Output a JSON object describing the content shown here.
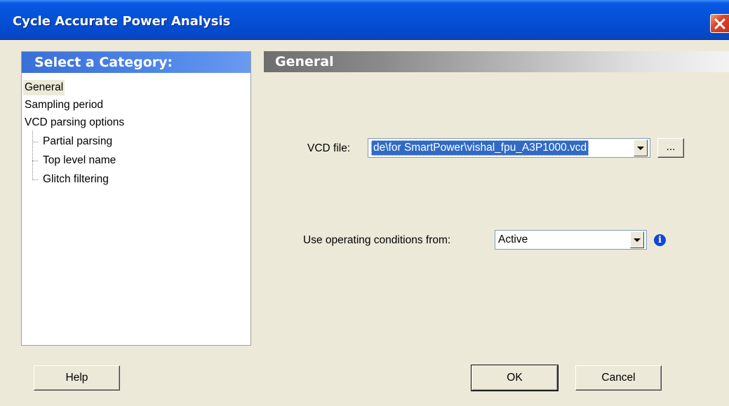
{
  "window": {
    "title": "Cycle Accurate Power Analysis"
  },
  "category_panel": {
    "header": "Select a Category:",
    "items": [
      {
        "label": "General",
        "level": 0,
        "selected": true
      },
      {
        "label": "Sampling period",
        "level": 0,
        "selected": false
      },
      {
        "label": "VCD parsing options",
        "level": 0,
        "selected": false
      },
      {
        "label": "Partial parsing",
        "level": 1,
        "selected": false
      },
      {
        "label": "Top level name",
        "level": 1,
        "selected": false
      },
      {
        "label": "Glitch filtering",
        "level": 1,
        "selected": false
      }
    ]
  },
  "general_panel": {
    "header": "General",
    "vcd_file": {
      "label": "VCD file:",
      "value": "de\\for SmartPower\\vishal_fpu_A3P1000.vcd",
      "browse_label": "..."
    },
    "operating_conditions": {
      "label": "Use operating conditions from:",
      "value": "Active",
      "info_icon": "info-icon"
    }
  },
  "buttons": {
    "help": "Help",
    "ok": "OK",
    "cancel": "Cancel"
  },
  "colors": {
    "titlebar": "#0552da",
    "category_header": "#4f86e8",
    "selection": "#316ac5",
    "dialog_bg": "#ece9d8",
    "close_button": "#d9462b"
  }
}
